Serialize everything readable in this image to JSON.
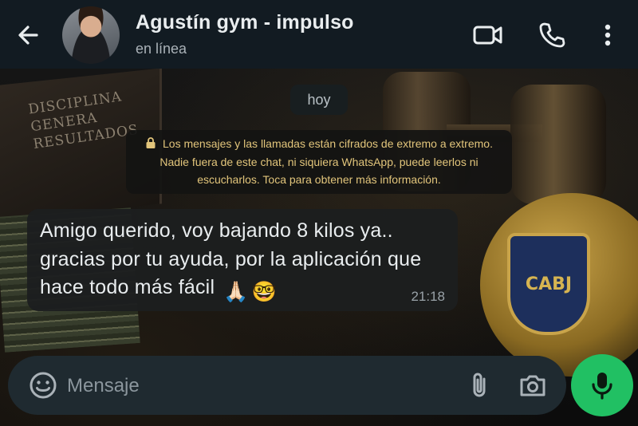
{
  "header": {
    "contact_name": "Agustín gym - impulso",
    "status": "en línea",
    "icons": [
      "back-arrow-icon",
      "video-call-icon",
      "phone-call-icon",
      "more-vert-icon"
    ]
  },
  "chat": {
    "date_chip": "hoy",
    "encryption_notice": "Los mensajes y las llamadas están cifrados de extremo a extremo. Nadie fuera de este chat, ni siquiera WhatsApp, puede leerlos ni escucharlos. Toca para obtener más información.",
    "messages": [
      {
        "text": "Amigo querido, voy bajando 8 kilos ya.. gracias por tu ayuda, por la aplicación que hace todo más fácil",
        "emojis": [
          "🙏🏻",
          "🤓"
        ],
        "time": "21:18",
        "direction": "incoming"
      }
    ],
    "wallpaper": {
      "poster_text": "DISCIPLINA GENERA RESULTADOS",
      "badge_text": "CABJ"
    }
  },
  "composer": {
    "placeholder": "Mensaje",
    "icons": [
      "emoji-icon",
      "attach-icon",
      "camera-icon",
      "microphone-icon"
    ]
  },
  "colors": {
    "header_bg": "#121b22",
    "accent": "#21c063",
    "notice_text": "#e2c57b",
    "bubble_bg": "#1c1e1f"
  }
}
